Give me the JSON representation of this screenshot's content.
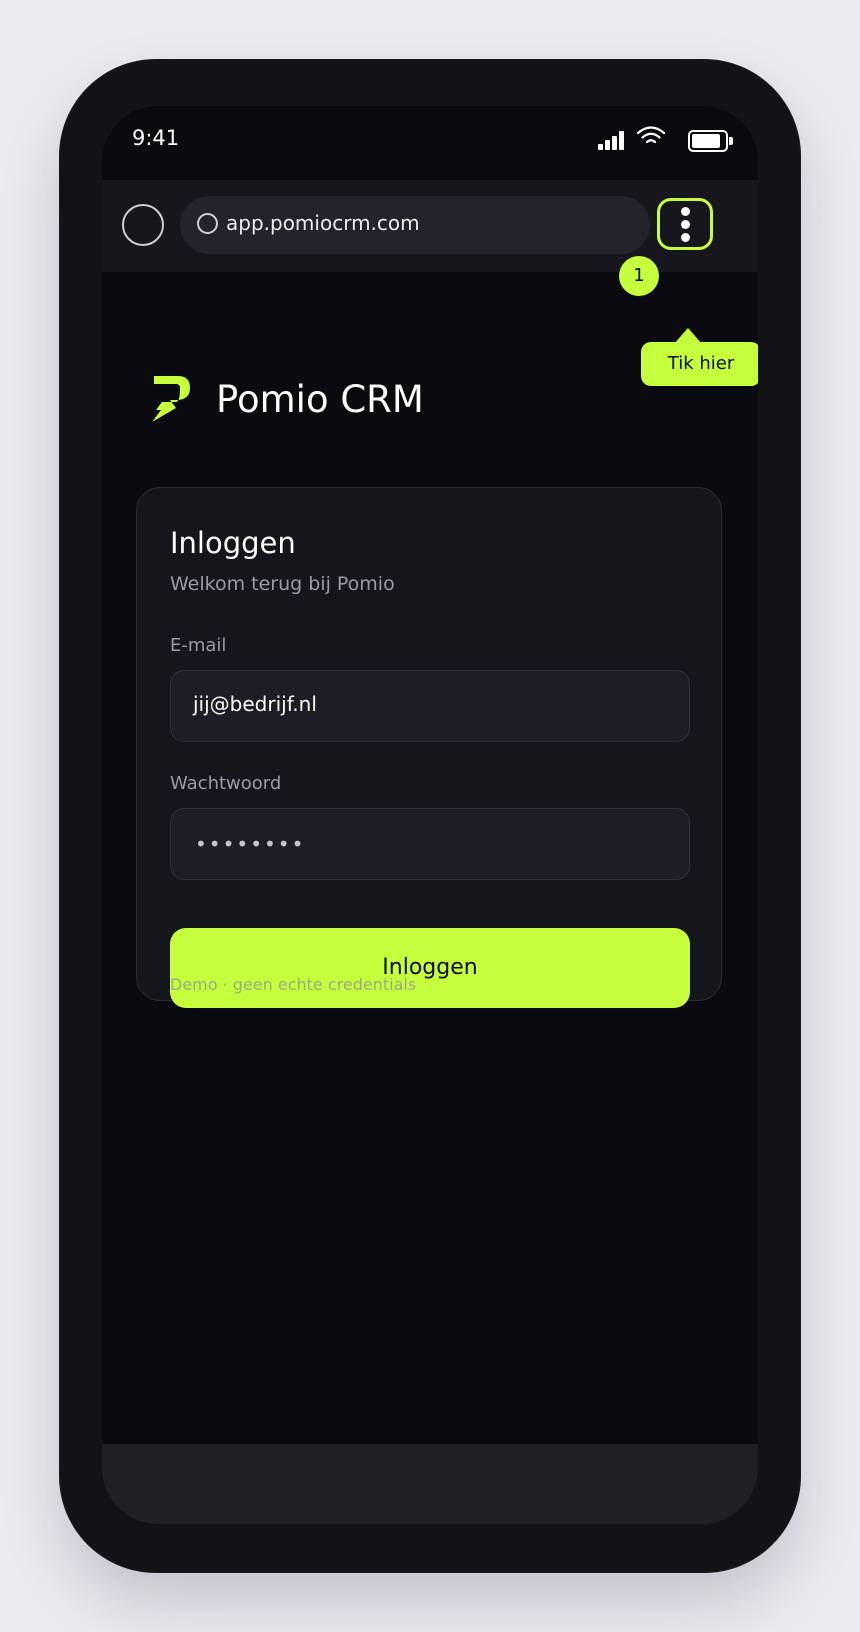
{
  "status_bar": {
    "time": "9:41"
  },
  "browser": {
    "url": "app.pomiocrm.com",
    "menu_badge": "1",
    "tooltip": "Tik hier"
  },
  "app": {
    "name": "Pomio CRM"
  },
  "login": {
    "title": "Inloggen",
    "subtitle": "Welkom terug bij Pomio",
    "email_label": "E-mail",
    "email_value": "jij@bedrijf.nl",
    "password_label": "Wachtwoord",
    "password_value": "••••••••",
    "button_label": "Inloggen",
    "demo_note": "Demo · geen echte credentials"
  },
  "colors": {
    "accent": "#c6ff3c",
    "background": "#0b0b0f",
    "card": "#15161c"
  },
  "icons": [
    "signal-icon",
    "wifi-icon",
    "battery-icon",
    "browser-home-icon",
    "globe-icon",
    "kebab-menu-icon",
    "pomio-logo"
  ]
}
